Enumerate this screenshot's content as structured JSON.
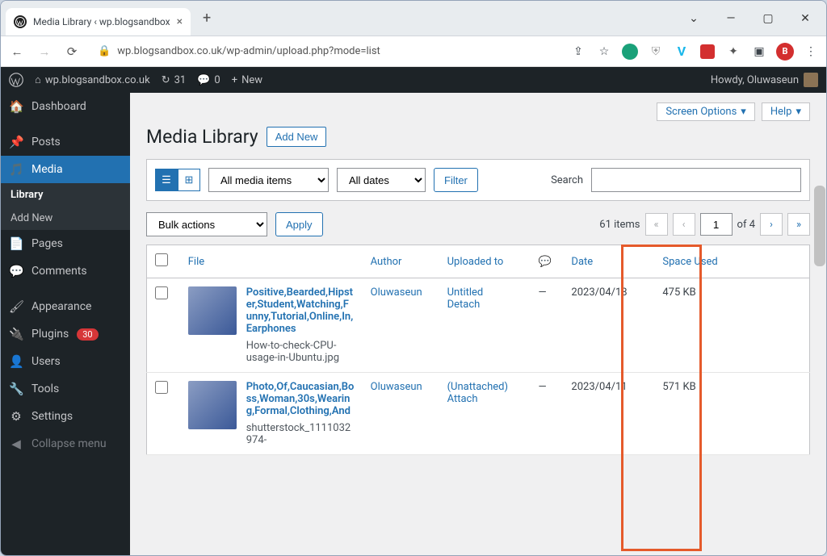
{
  "browser": {
    "tab_title": "Media Library ‹ wp.blogsandbox",
    "url": "wp.blogsandbox.co.uk/wp-admin/upload.php?mode=list"
  },
  "adminbar": {
    "site": "wp.blogsandbox.co.uk",
    "updates": "31",
    "comments": "0",
    "new": "New",
    "howdy": "Howdy, Oluwaseun"
  },
  "sidebar": {
    "dashboard": "Dashboard",
    "posts": "Posts",
    "media": "Media",
    "library": "Library",
    "add_new": "Add New",
    "pages": "Pages",
    "comments": "Comments",
    "appearance": "Appearance",
    "plugins": "Plugins",
    "plugins_count": "30",
    "users": "Users",
    "tools": "Tools",
    "settings": "Settings",
    "collapse": "Collapse menu"
  },
  "screen": {
    "options": "Screen Options",
    "help": "Help"
  },
  "page": {
    "title": "Media Library",
    "add_new": "Add New"
  },
  "filters": {
    "media_items": "All media items",
    "dates": "All dates",
    "filter": "Filter",
    "search": "Search"
  },
  "bulk": {
    "actions": "Bulk actions",
    "apply": "Apply"
  },
  "pager": {
    "items": "61 items",
    "current": "1",
    "total": "of 4"
  },
  "cols": {
    "file": "File",
    "author": "Author",
    "uploaded": "Uploaded to",
    "date": "Date",
    "space": "Space Used"
  },
  "rows": [
    {
      "title": "Positive,Bearded,Hipster,Student,Watching,Funny,Tutorial,Online,In,Earphones",
      "filename": "How-to-check-CPU-usage-in-Ubuntu.jpg",
      "author": "Oluwaseun",
      "uploaded": "Untitled",
      "uploaded_action": "Detach",
      "comments": "—",
      "date": "2023/04/18",
      "space": "475 KB"
    },
    {
      "title": "Photo,Of,Caucasian,Boss,Woman,30s,Wearing,Formal,Clothing,And",
      "filename": "shutterstock_1111032974-",
      "author": "Oluwaseun",
      "uploaded": "(Unattached)",
      "uploaded_action": "Attach",
      "comments": "—",
      "date": "2023/04/11",
      "space": "571 KB"
    }
  ]
}
